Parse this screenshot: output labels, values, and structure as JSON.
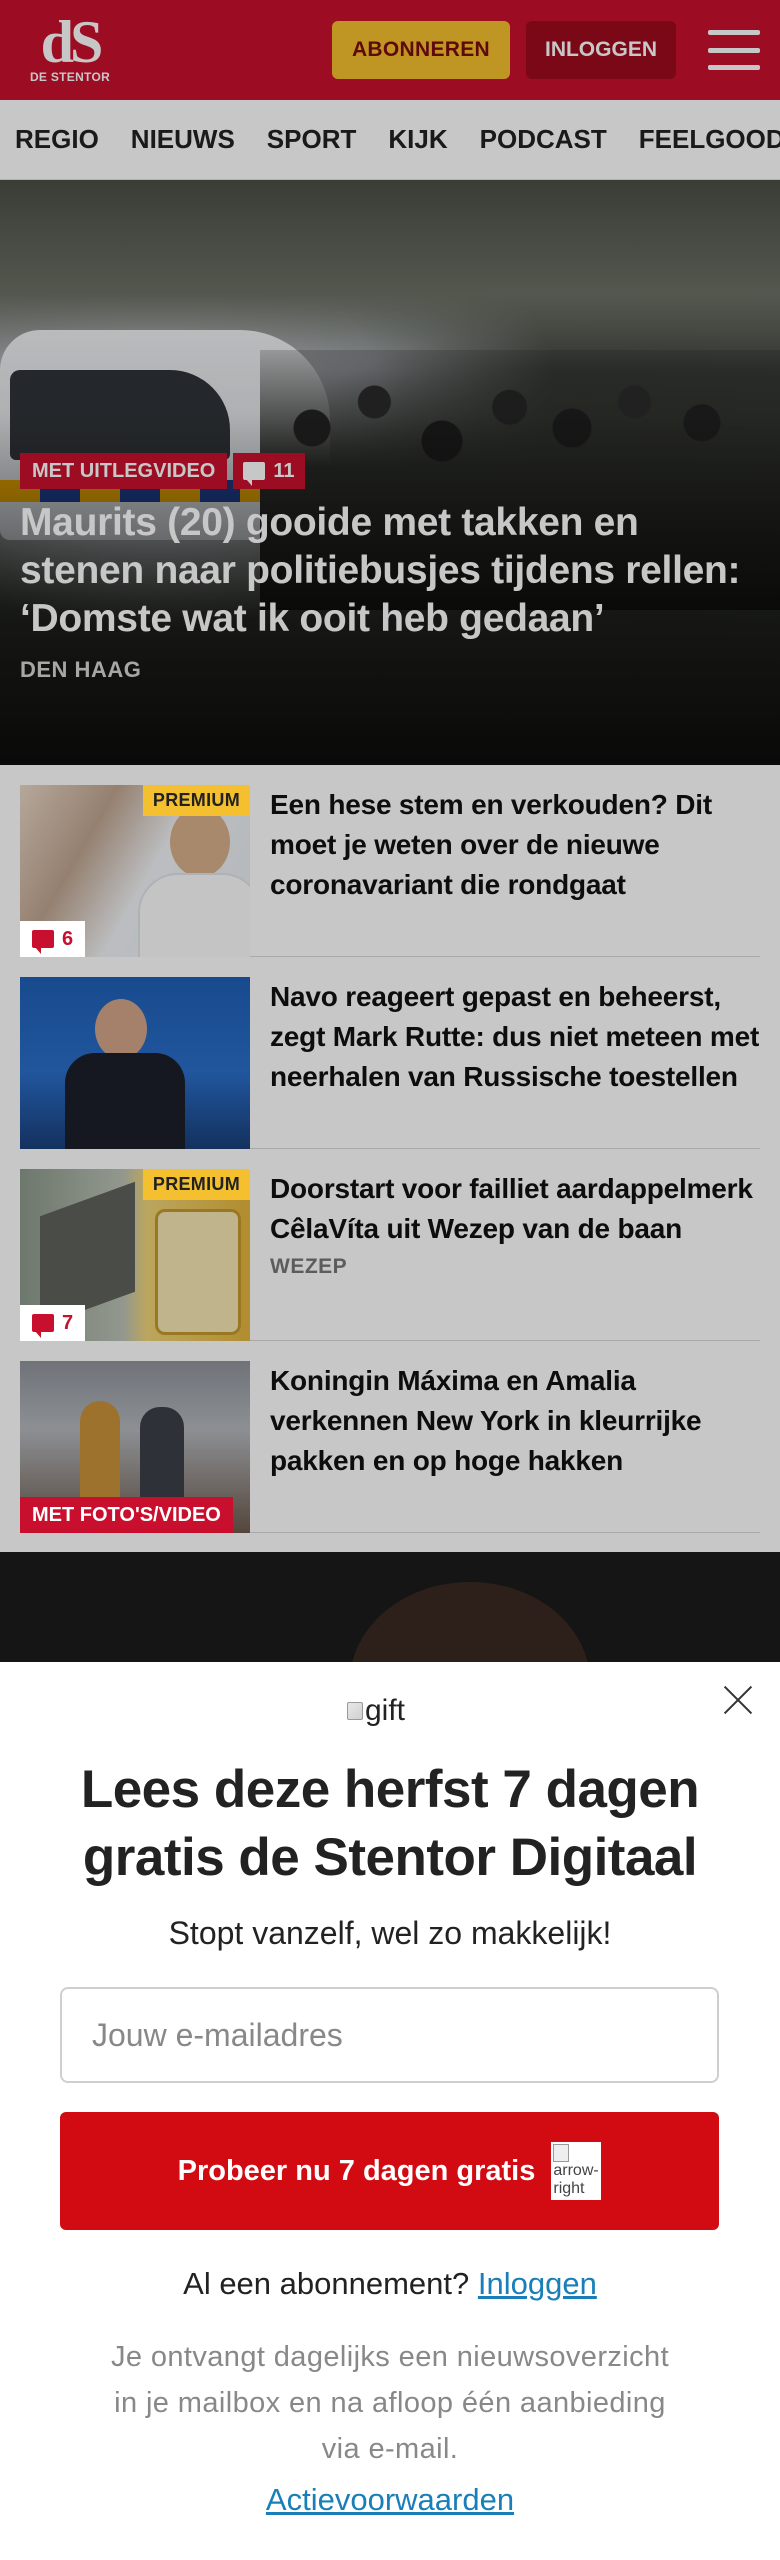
{
  "header": {
    "logo_mark": "dS",
    "logo_sub": "DE STENTOR",
    "subscribe_label": "ABONNEREN",
    "login_label": "INLOGGEN",
    "brand_color": "#c8102e",
    "accent_color": "#f5c02f"
  },
  "nav": {
    "items": [
      "REGIO",
      "NIEUWS",
      "SPORT",
      "KIJK",
      "PODCAST",
      "FEELGOOD"
    ]
  },
  "hero": {
    "tag": "MET UITLEGVIDEO",
    "comment_count": "11",
    "title": "Maurits (20) gooide met takken en stenen naar politiebusjes tijdens rellen: ‘Domste wat ik ooit heb gedaan’",
    "location": "DEN HAAG"
  },
  "articles": [
    {
      "title": "Een hese stem en verkouden? Dit moet je weten over de nieuwe coronavariant die rondgaat",
      "premium": "PREMIUM",
      "comments": "6"
    },
    {
      "title": "Navo reageert gepast en beheerst, zegt Mark Rutte: dus niet meteen met neerhalen van Russische toestellen"
    },
    {
      "title": "Doorstart voor failliet aardappel­merk CêlaVíta uit Wezep van de baan",
      "premium": "PREMIUM",
      "comments": "7",
      "location": "WEZEP"
    },
    {
      "title": "Koningin Máxima en Amalia verkennen New York in kleurrijke pakken en op hoge hakken",
      "tag": "MET FOTO'S/VIDEO"
    }
  ],
  "modal": {
    "gift_alt": "gift",
    "title": "Lees deze herfst 7 dagen gratis de Stentor Digitaal",
    "subtitle": "Stopt vanzelf, wel zo makkelijk!",
    "email_placeholder": "Jouw e-mailadres",
    "cta_label": "Probeer nu 7 dagen gratis",
    "cta_icon_alt": "arrow-right",
    "login_prompt": "Al een abonnement?",
    "login_link": "Inloggen",
    "info": "Je ontvangt dagelijks een nieuwsoverzicht in je mailbox en na afloop één aanbieding via e-mail.",
    "terms_link": "Actievoorwaarden",
    "cta_color": "#d20a11",
    "link_color": "#1a7fb8"
  }
}
